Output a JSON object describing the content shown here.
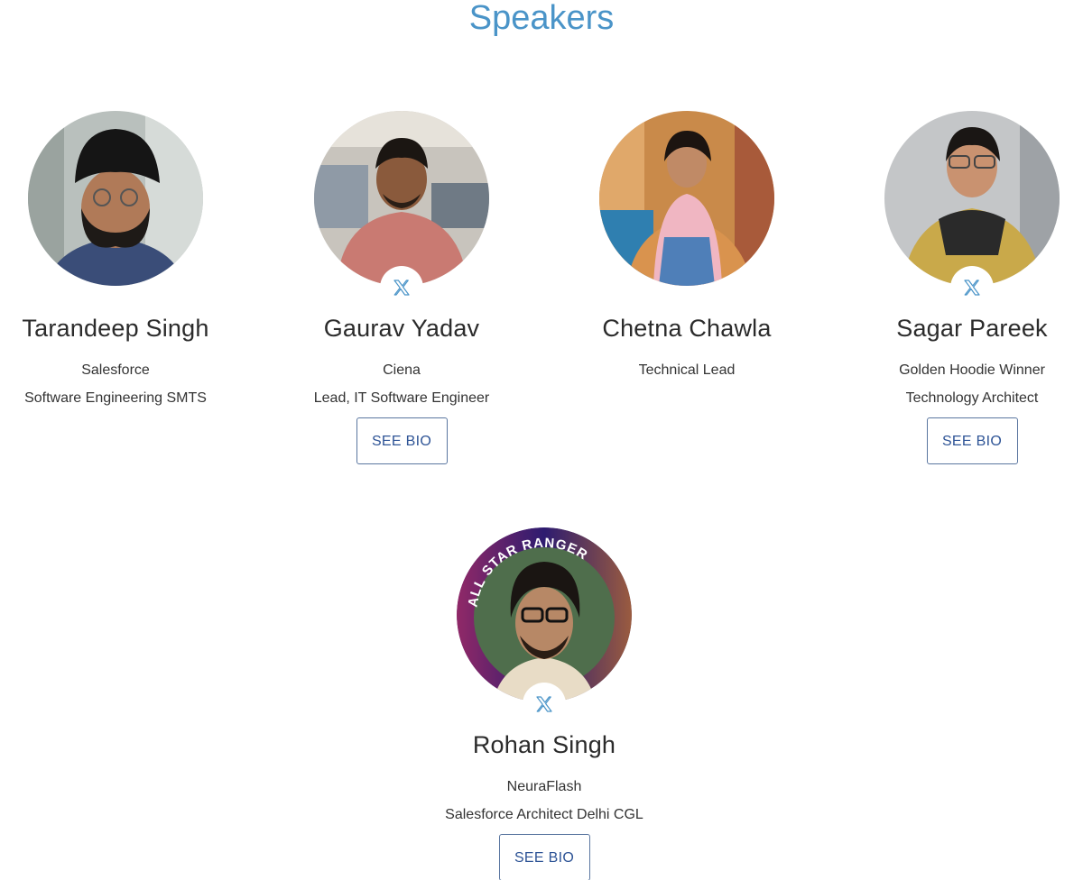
{
  "section": {
    "title": "Speakers"
  },
  "speakers": [
    {
      "name": "Tarandeep Singh",
      "company": "Salesforce",
      "role": "Software Engineering SMTS",
      "has_twitter": false,
      "has_bio": false
    },
    {
      "name": "Gaurav Yadav",
      "company": "Ciena",
      "role": "Lead, IT Software Engineer",
      "has_twitter": true,
      "has_bio": true
    },
    {
      "name": "Chetna Chawla",
      "company": "Technical Lead",
      "role": "",
      "has_twitter": false,
      "has_bio": false
    },
    {
      "name": "Sagar Pareek",
      "company": "Golden Hoodie Winner",
      "role": "Technology Architect",
      "has_twitter": true,
      "has_bio": true
    },
    {
      "name": "Rohan Singh",
      "company": "NeuraFlash",
      "role": "Salesforce Architect Delhi CGL",
      "has_twitter": true,
      "has_bio": true,
      "badge_text": "ALL STAR RANGER"
    }
  ],
  "buttons": {
    "see_bio_label": "SEE BIO"
  },
  "icons": {
    "social": "x-twitter-icon"
  },
  "colors": {
    "title": "#4a94c8",
    "button_text": "#2e5496",
    "button_border": "#5a76a0",
    "x_icon": "#4a94c8"
  }
}
